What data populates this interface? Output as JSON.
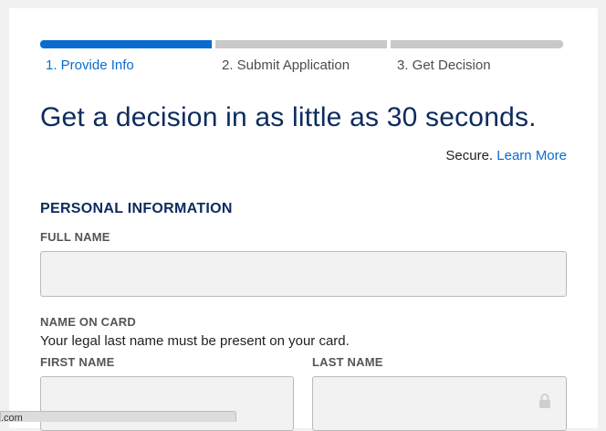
{
  "steps": [
    {
      "label": "1. Provide Info",
      "active": true
    },
    {
      "label": "2. Submit Application",
      "active": false
    },
    {
      "label": "3. Get Decision",
      "active": false
    }
  ],
  "progress": {
    "current_step": 1,
    "total_steps": 3
  },
  "headline": "Get a decision in as little as 30 seconds.",
  "secure": {
    "text": "Secure.",
    "link": "Learn More"
  },
  "personal_info": {
    "title": "PERSONAL INFORMATION",
    "full_name_label": "FULL NAME",
    "full_name_value": "",
    "name_on_card_label": "NAME ON CARD",
    "name_on_card_help": "Your legal last name must be present on your card.",
    "first_name_label": "FIRST NAME",
    "first_name_value": "",
    "last_name_label": "LAST NAME",
    "last_name_value": ""
  },
  "status_bar": {
    "text": ".com"
  },
  "colors": {
    "accent": "#0a6cce",
    "heading": "#0d2b5e",
    "inactive": "#c9c9c9"
  },
  "icons": {
    "last_name_field": "lock-icon"
  }
}
